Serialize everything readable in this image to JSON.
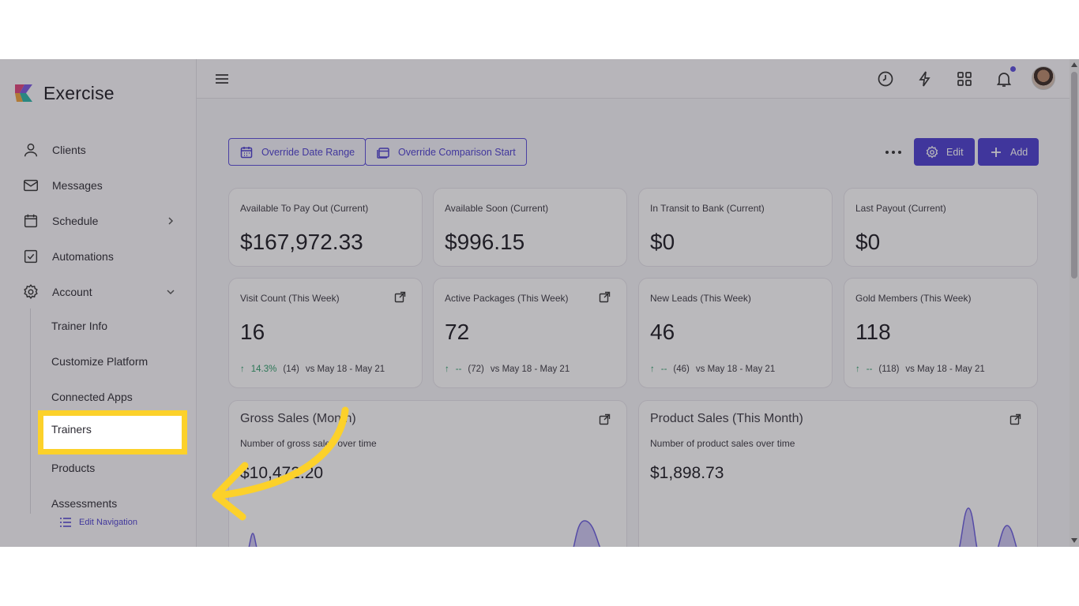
{
  "brand": {
    "name": "Exercise"
  },
  "sidebar": {
    "items": [
      {
        "label": "Clients",
        "icon": "user-icon"
      },
      {
        "label": "Messages",
        "icon": "mail-icon"
      },
      {
        "label": "Schedule",
        "icon": "calendar-icon"
      },
      {
        "label": "Automations",
        "icon": "checkbox-icon"
      },
      {
        "label": "Account",
        "icon": "gear-icon"
      }
    ],
    "account_sub": [
      "Trainer Info",
      "Customize Platform",
      "Connected Apps",
      "Trainers",
      "Products",
      "Assessments"
    ],
    "edit_navigation": "Edit Navigation"
  },
  "topbar": {
    "icons": [
      "history-icon",
      "bolt-icon",
      "grid-icon",
      "bell-icon"
    ],
    "has_notification": true
  },
  "actions": {
    "override_date_range": "Override Date Range",
    "override_comparison_start": "Override Comparison Start",
    "edit": "Edit",
    "add": "Add"
  },
  "payout_cards": [
    {
      "label": "Available To Pay Out (Current)",
      "value": "$167,972.33"
    },
    {
      "label": "Available Soon (Current)",
      "value": "$996.15"
    },
    {
      "label": "In Transit to Bank (Current)",
      "value": "$0"
    },
    {
      "label": "Last Payout (Current)",
      "value": "$0"
    }
  ],
  "weekly_cards": [
    {
      "label": "Visit Count (This Week)",
      "value": "16",
      "change": "14.3%",
      "prev": "(14)",
      "period": "vs May 18 - May 21"
    },
    {
      "label": "Active Packages (This Week)",
      "value": "72",
      "change": "--",
      "prev": "(72)",
      "period": "vs May 18 - May 21"
    },
    {
      "label": "New Leads (This Week)",
      "value": "46",
      "change": "--",
      "prev": "(46)",
      "period": "vs May 18 - May 21"
    },
    {
      "label": "Gold Members (This Week)",
      "value": "118",
      "change": "--",
      "prev": "(118)",
      "period": "vs May 18 - May 21"
    }
  ],
  "chart_cards": [
    {
      "title": "Gross Sales (Month)",
      "subtitle": "Number of gross sales over time",
      "value": "$10,472.20"
    },
    {
      "title": "Product Sales (This Month)",
      "subtitle": "Number of product sales over time",
      "value": "$1,898.73"
    }
  ],
  "colors": {
    "accent": "#4c3fd0",
    "highlight": "#fcd12a",
    "trend_up": "#2e9e6a"
  }
}
